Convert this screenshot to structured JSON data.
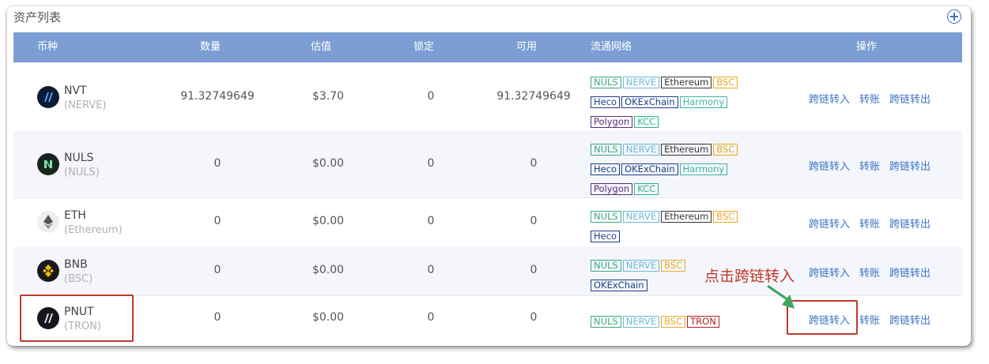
{
  "panel": {
    "title": "资产列表"
  },
  "headers": {
    "coin": "币种",
    "amount": "数量",
    "value": "估值",
    "locked": "锁定",
    "available": "可用",
    "networks": "流通网络",
    "actions": "操作"
  },
  "actions": {
    "cross_in": "跨链转入",
    "transfer": "转账",
    "cross_out": "跨链转出"
  },
  "rows": [
    {
      "symbol": "NVT",
      "chain": "(NERVE)",
      "amount": "91.32749649",
      "value": "$3.70",
      "locked": "0",
      "available": "91.32749649",
      "networks": [
        "NULS",
        "NERVE",
        "Ethereum",
        "BSC",
        "Heco",
        "OKExChain",
        "Harmony",
        "Polygon",
        "KCC"
      ]
    },
    {
      "symbol": "NULS",
      "chain": "(NULS)",
      "amount": "0",
      "value": "$0.00",
      "locked": "0",
      "available": "0",
      "networks": [
        "NULS",
        "NERVE",
        "Ethereum",
        "BSC",
        "Heco",
        "OKExChain",
        "Harmony",
        "Polygon",
        "KCC"
      ]
    },
    {
      "symbol": "ETH",
      "chain": "(Ethereum)",
      "amount": "0",
      "value": "$0.00",
      "locked": "0",
      "available": "0",
      "networks": [
        "NULS",
        "NERVE",
        "Ethereum",
        "BSC",
        "Heco"
      ]
    },
    {
      "symbol": "BNB",
      "chain": "(BSC)",
      "amount": "0",
      "value": "$0.00",
      "locked": "0",
      "available": "0",
      "networks": [
        "NULS",
        "NERVE",
        "BSC",
        "OKExChain"
      ]
    },
    {
      "symbol": "PNUT",
      "chain": "(TRON)",
      "amount": "0",
      "value": "$0.00",
      "locked": "0",
      "available": "0",
      "networks": [
        "NULS",
        "NERVE",
        "BSC",
        "TRON"
      ]
    }
  ],
  "annotation": {
    "callout_text": "点击跨链转入"
  },
  "colors": {
    "header_bg": "#7c9ed2",
    "link": "#3c74c4",
    "highlight": "#c0392b",
    "alt_row": "#f4f6fb"
  }
}
